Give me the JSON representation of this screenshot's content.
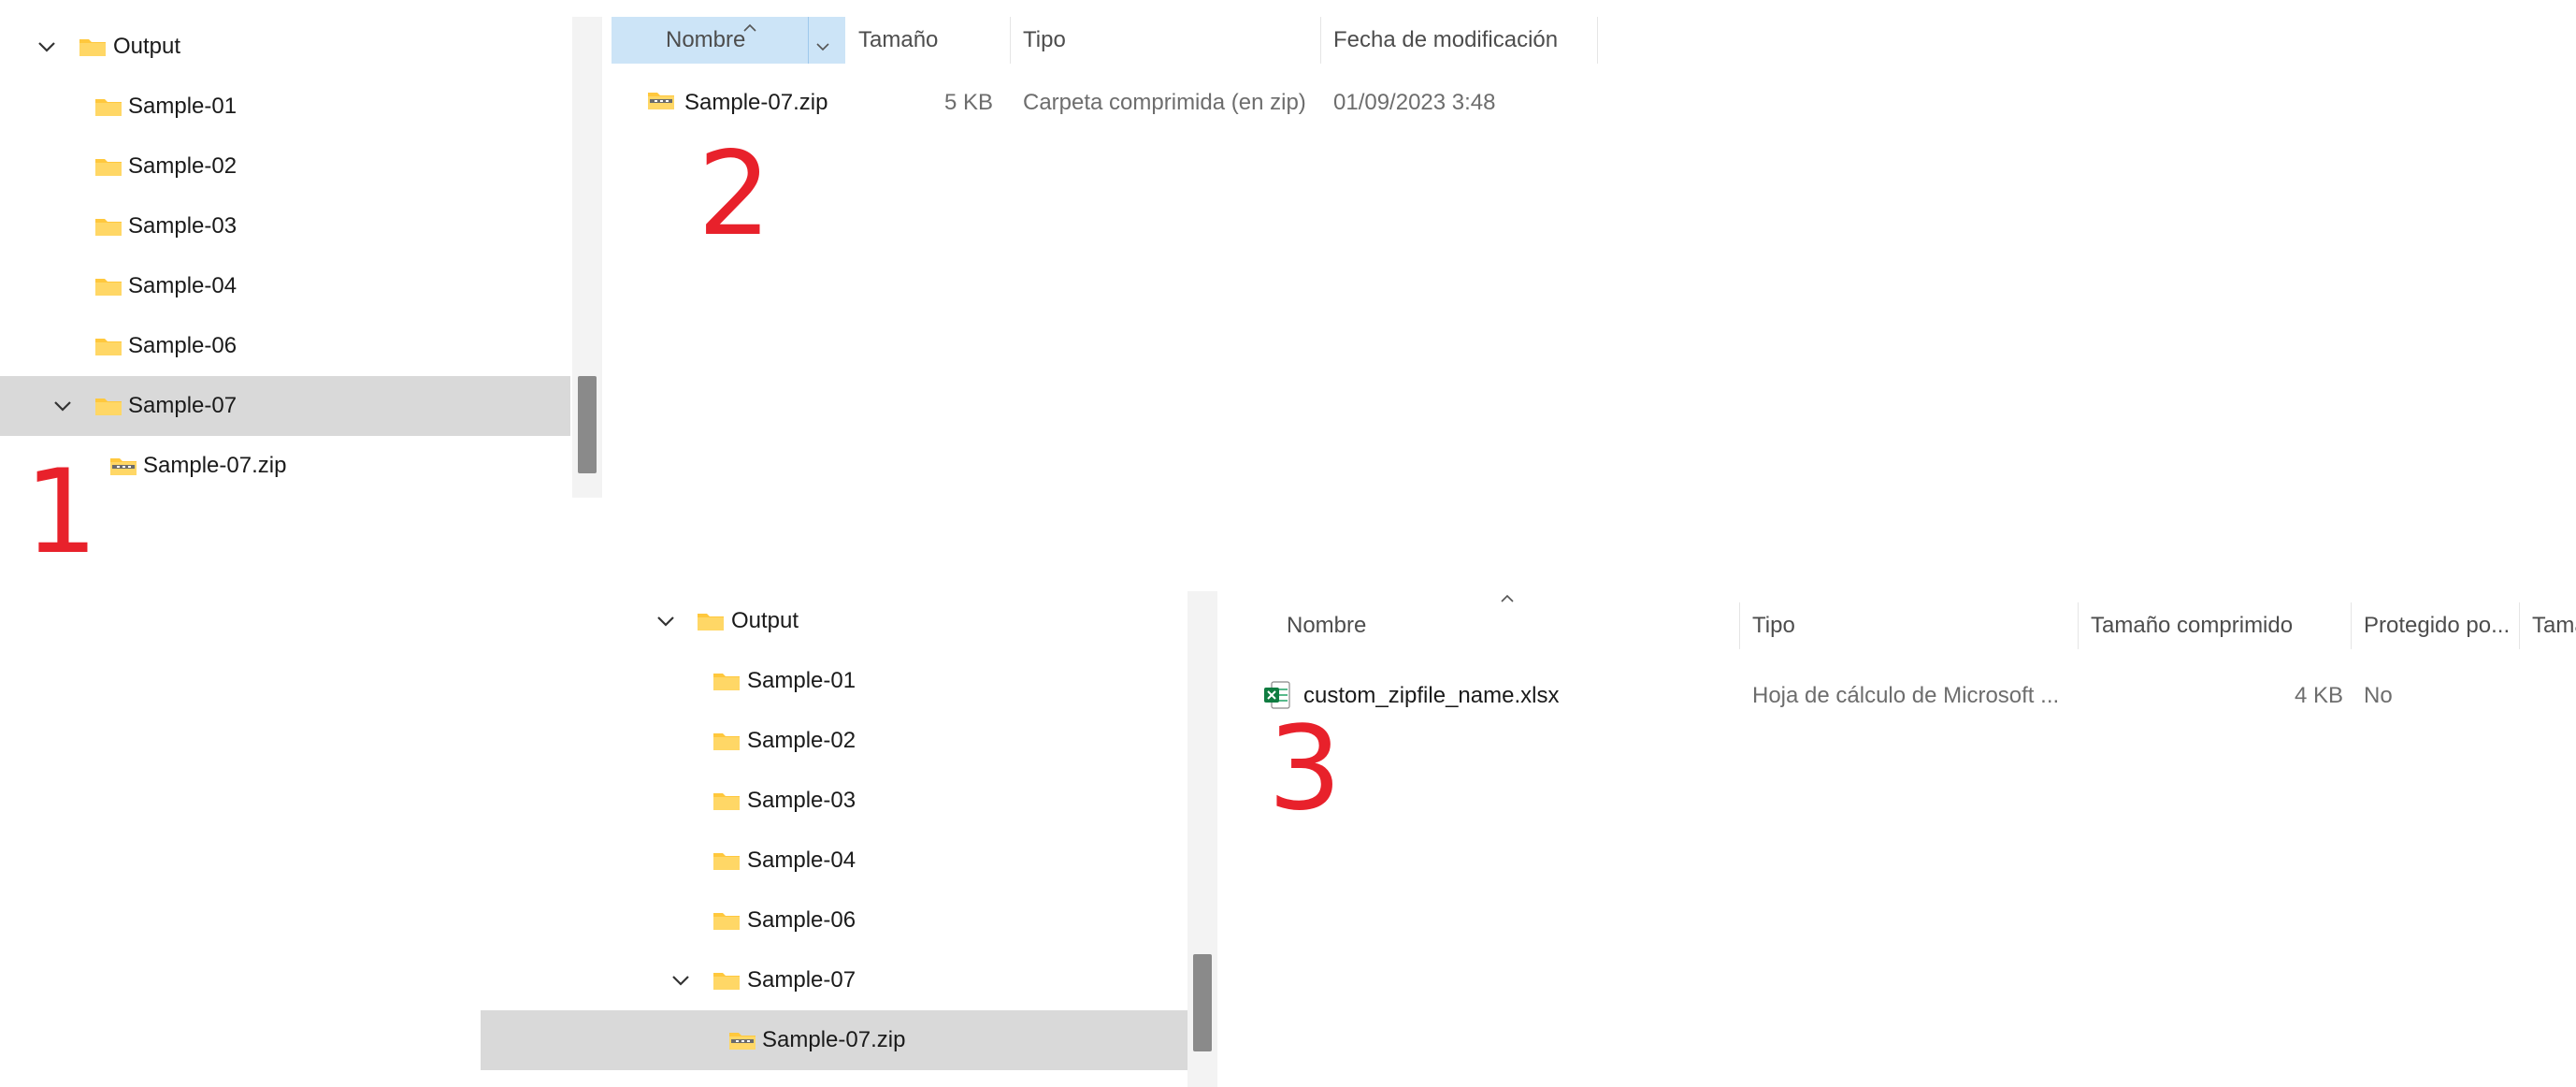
{
  "panel1": {
    "tree": [
      {
        "label": "Output",
        "expanded": true,
        "icon": "folder-icon"
      },
      {
        "label": "Sample-01",
        "icon": "folder-icon"
      },
      {
        "label": "Sample-02",
        "icon": "folder-icon"
      },
      {
        "label": "Sample-03",
        "icon": "folder-icon"
      },
      {
        "label": "Sample-04",
        "icon": "folder-icon"
      },
      {
        "label": "Sample-06",
        "icon": "folder-icon"
      },
      {
        "label": "Sample-07",
        "expanded": true,
        "selected": true,
        "icon": "folder-icon"
      },
      {
        "label": "Sample-07.zip",
        "icon": "zip-folder-icon"
      }
    ],
    "marker": "1"
  },
  "panel2": {
    "columns": {
      "name": "Nombre",
      "size": "Tamaño",
      "type": "Tipo",
      "modified": "Fecha de modificación"
    },
    "rows": [
      {
        "name": "Sample-07.zip",
        "size": "5 KB",
        "type": "Carpeta comprimida (en zip)",
        "modified": "01/09/2023 3:48",
        "icon": "zip-folder-icon"
      }
    ],
    "marker": "2"
  },
  "panel3": {
    "tree": [
      {
        "label": "Output",
        "expanded": true,
        "icon": "folder-icon"
      },
      {
        "label": "Sample-01",
        "icon": "folder-icon"
      },
      {
        "label": "Sample-02",
        "icon": "folder-icon"
      },
      {
        "label": "Sample-03",
        "icon": "folder-icon"
      },
      {
        "label": "Sample-04",
        "icon": "folder-icon"
      },
      {
        "label": "Sample-06",
        "icon": "folder-icon"
      },
      {
        "label": "Sample-07",
        "expanded": true,
        "icon": "folder-icon"
      },
      {
        "label": "Sample-07.zip",
        "selected": true,
        "icon": "zip-folder-icon"
      }
    ],
    "columns": {
      "name": "Nombre",
      "type": "Tipo",
      "compressed": "Tamaño comprimido",
      "protected": "Protegido po...",
      "size": "Tamaí"
    },
    "rows": [
      {
        "name": "custom_zipfile_name.xlsx",
        "type": "Hoja de cálculo de Microsoft ...",
        "compressed": "4 KB",
        "protected": "No",
        "icon": "excel-file-icon"
      }
    ],
    "marker": "3"
  },
  "colors": {
    "selection": "#d9d9d9",
    "header_selected": "#cce4f7",
    "folder": "#ffc83d",
    "marker": "#e8212b",
    "excel_green": "#107c41"
  }
}
